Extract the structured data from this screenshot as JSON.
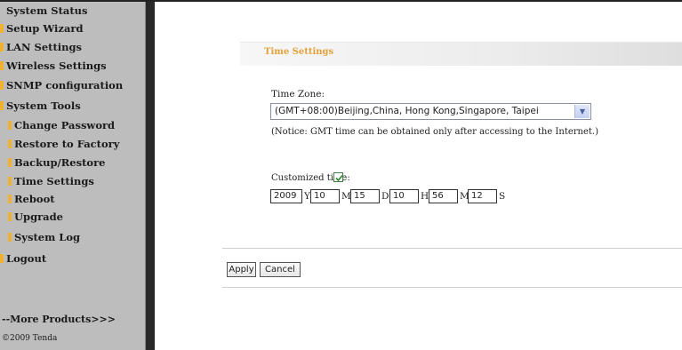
{
  "sidebar": {
    "items": [
      {
        "label": "System Status",
        "marker": false,
        "sub": false
      },
      {
        "label": "Setup Wizard",
        "marker": true,
        "sub": false
      },
      {
        "label": "LAN Settings",
        "marker": true,
        "sub": false
      },
      {
        "label": "Wireless Settings",
        "marker": true,
        "sub": false
      },
      {
        "label": "SNMP configuration",
        "marker": true,
        "sub": false
      },
      {
        "label": "System Tools",
        "marker": true,
        "sub": false
      },
      {
        "label": "Change Password",
        "marker": true,
        "sub": true
      },
      {
        "label": "Restore to Factory",
        "marker": true,
        "sub": true
      },
      {
        "label": "Backup/Restore",
        "marker": true,
        "sub": true
      },
      {
        "label": "Time Settings",
        "marker": true,
        "sub": true
      },
      {
        "label": "Reboot",
        "marker": true,
        "sub": true
      },
      {
        "label": "Upgrade",
        "marker": true,
        "sub": true
      },
      {
        "label": "System Log",
        "marker": true,
        "sub": true
      },
      {
        "label": "Logout",
        "marker": true,
        "sub": false
      }
    ],
    "more_products": "--More Products>>>",
    "copyright": "©2009 Tenda"
  },
  "panel": {
    "title": "Time Settings"
  },
  "time_zone": {
    "label": "Time Zone:",
    "selected": "(GMT+08:00)Beijing,China, Hong Kong,Singapore, Taipei",
    "notice": "(Notice: GMT time can be obtained only after accessing to the Internet.)"
  },
  "custom_time": {
    "label": "Customized time:",
    "checked": true,
    "year": "2009",
    "year_unit": "Y",
    "month": "10",
    "month_unit": "M",
    "day": "15",
    "day_unit": "D",
    "hour": "10",
    "hour_unit": "H",
    "minute": "56",
    "minute_unit": "M",
    "second": "12",
    "second_unit": "S"
  },
  "buttons": {
    "apply": "Apply",
    "cancel": "Cancel"
  },
  "colors": {
    "sidebar_bg": "#bdbdbd",
    "marker": "#f0b030",
    "title_accent": "#e2a23a"
  }
}
